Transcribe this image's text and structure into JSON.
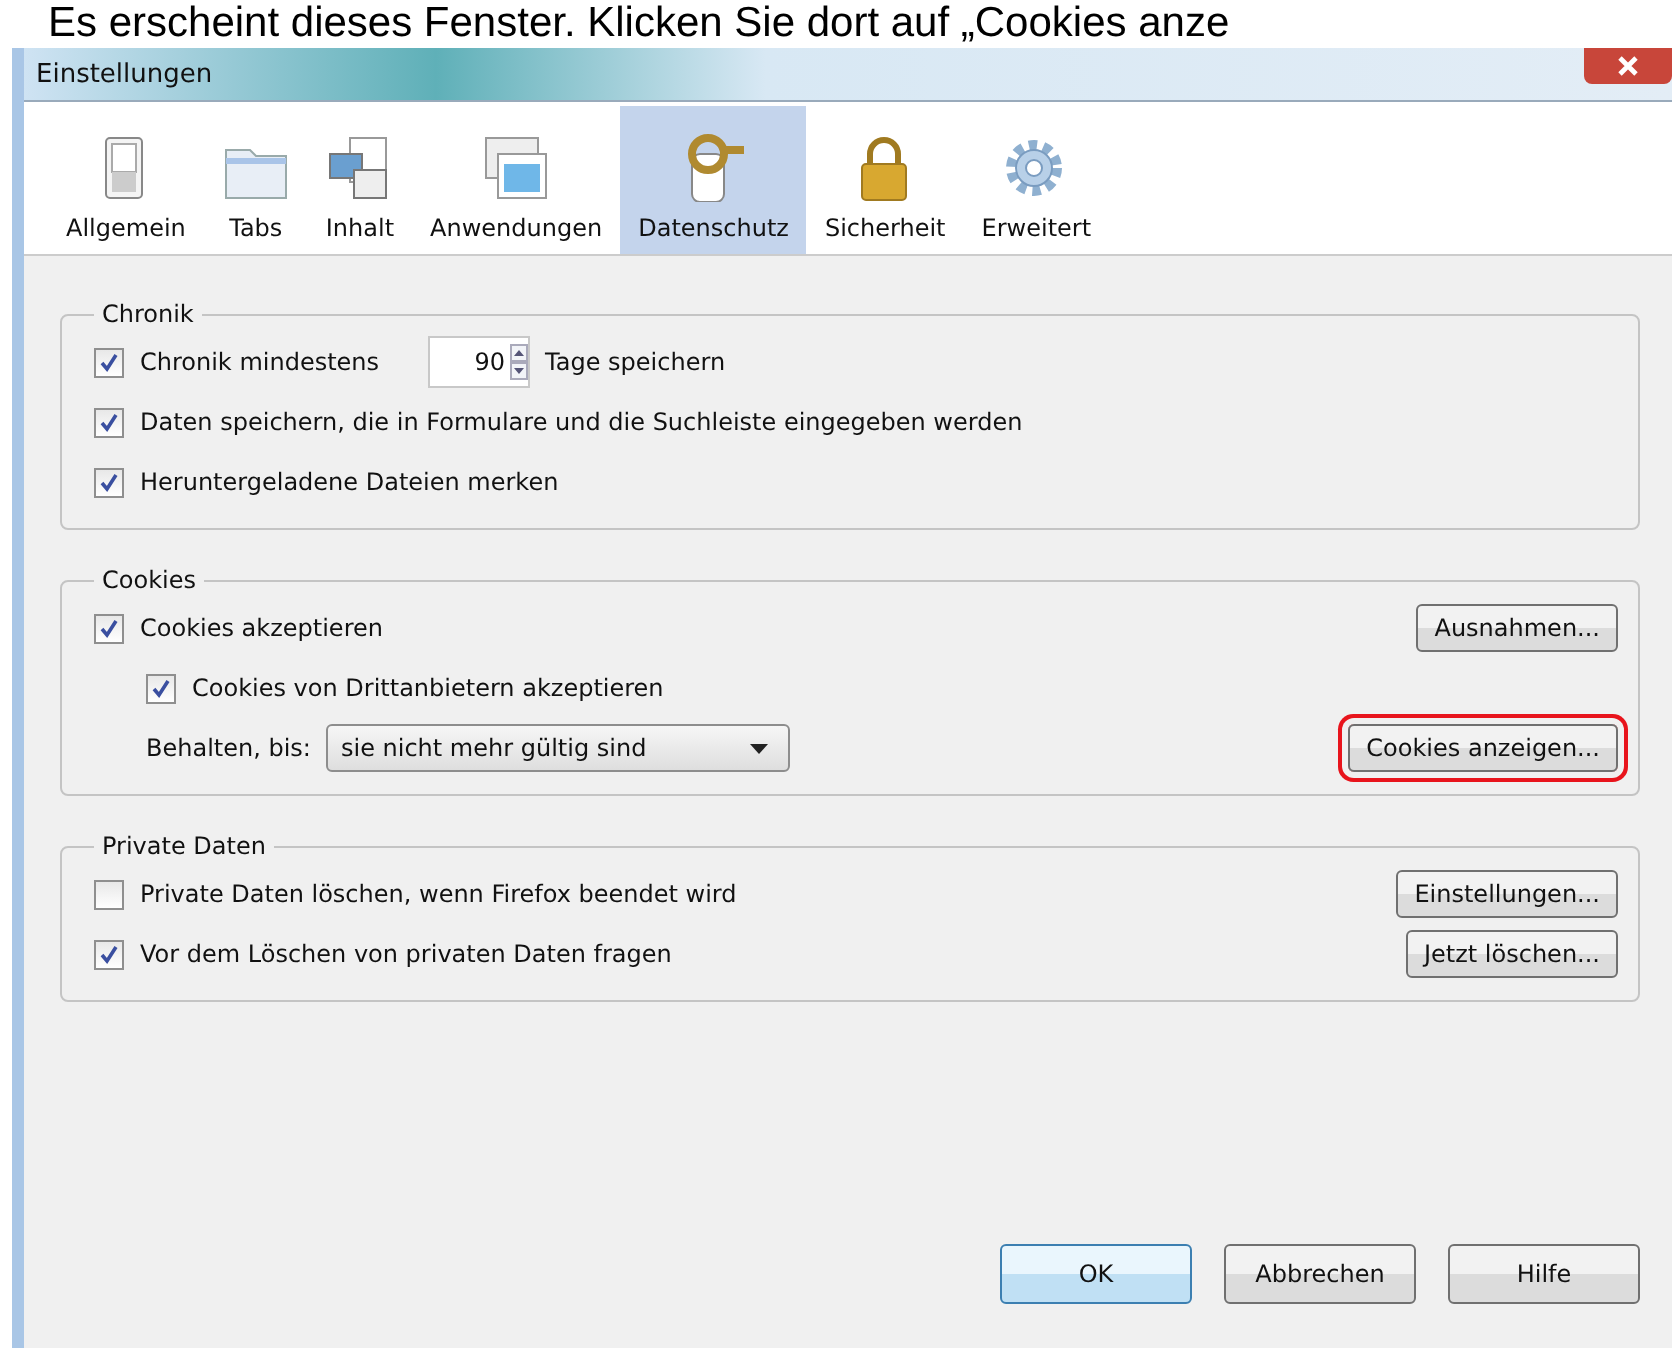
{
  "caption": "Es erscheint dieses Fenster. Klicken Sie dort auf „Cookies anze",
  "window": {
    "title": "Einstellungen"
  },
  "toolbar": [
    {
      "kind": "switch",
      "label": "Allgemein",
      "selected": false
    },
    {
      "kind": "folder",
      "label": "Tabs",
      "selected": false
    },
    {
      "kind": "content",
      "label": "Inhalt",
      "selected": false
    },
    {
      "kind": "apps",
      "label": "Anwendungen",
      "selected": false
    },
    {
      "kind": "key",
      "label": "Datenschutz",
      "selected": true
    },
    {
      "kind": "lock",
      "label": "Sicherheit",
      "selected": false
    },
    {
      "kind": "gear",
      "label": "Erweitert",
      "selected": false
    }
  ],
  "groups": [
    {
      "title": "Chronik",
      "rows": [
        {
          "kind": "checkbox_spin",
          "label": "Chronik mindestens",
          "checked": true,
          "value": "90",
          "suffix": "Tage speichern"
        },
        {
          "kind": "checkbox",
          "label": "Daten speichern, die in Formulare und die Suchleiste eingegeben werden",
          "checked": true
        },
        {
          "kind": "checkbox",
          "label": "Heruntergeladene Dateien merken",
          "checked": true
        }
      ]
    },
    {
      "title": "Cookies",
      "rows": [
        {
          "kind": "checkbox",
          "label": "Cookies akzeptieren",
          "checked": true,
          "button": {
            "label": "Ausnahmen...",
            "highlighted": false
          },
          "children": [
            {
              "kind": "checkbox",
              "label": "Cookies von Drittanbietern akzeptieren",
              "checked": true
            },
            {
              "kind": "dropdown",
              "label": "Behalten, bis:",
              "value": "sie nicht mehr gültig sind",
              "button": {
                "label": "Cookies anzeigen...",
                "highlighted": true
              }
            }
          ]
        }
      ]
    },
    {
      "title": "Private Daten",
      "rows": [
        {
          "kind": "checkbox",
          "label": "Private Daten löschen, wenn Firefox beendet wird",
          "checked": false,
          "button": {
            "label": "Einstellungen...",
            "highlighted": false
          }
        },
        {
          "kind": "checkbox",
          "label": "Vor dem Löschen von privaten Daten fragen",
          "checked": true,
          "button": {
            "label": "Jetzt löschen...",
            "highlighted": false
          }
        }
      ]
    }
  ],
  "buttons": [
    {
      "label": "OK",
      "default": true
    },
    {
      "label": "Abbrechen",
      "default": false
    },
    {
      "label": "Hilfe",
      "default": false
    }
  ]
}
